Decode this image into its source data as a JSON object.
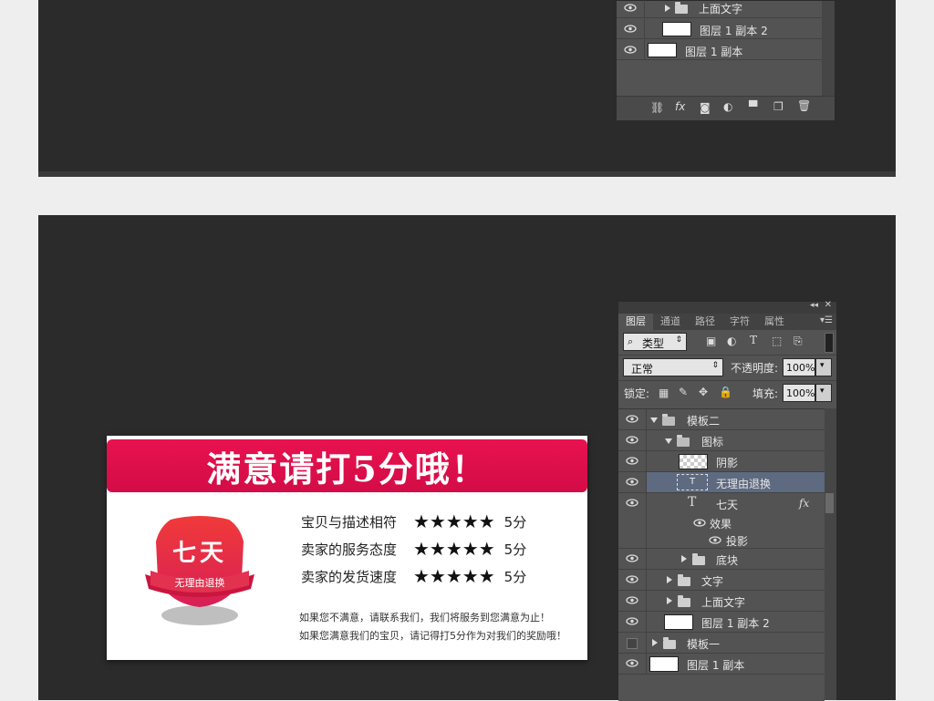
{
  "top_panel": {
    "layers": [
      {
        "name": "上面文字",
        "type": "folder"
      },
      {
        "name": "图层 1 副本 2",
        "type": "layer"
      },
      {
        "name": "图层 1 副本",
        "type": "layer"
      }
    ],
    "footer_icons": [
      "link-icon",
      "fx-icon",
      "mask-icon",
      "adjustment-icon",
      "folder-icon",
      "new-layer-icon",
      "trash-icon"
    ]
  },
  "panel": {
    "tabs": [
      "图层",
      "通道",
      "路径",
      "字符",
      "属性"
    ],
    "filter_label": "类型",
    "blend_mode": "正常",
    "opacity_label": "不透明度:",
    "opacity_value": "100%",
    "lock_label": "锁定:",
    "fill_label": "填充:",
    "fill_value": "100%",
    "layers": [
      {
        "name": "模板二",
        "kind": "group-open"
      },
      {
        "name": "图标",
        "kind": "group-open"
      },
      {
        "name": "阴影",
        "kind": "layer-transparent"
      },
      {
        "name": "无理由退换",
        "kind": "text-selected"
      },
      {
        "name": "七天",
        "kind": "text-fx"
      },
      {
        "name": "效果",
        "kind": "effect"
      },
      {
        "name": "投影",
        "kind": "effect-item"
      },
      {
        "name": "底块",
        "kind": "group-closed"
      },
      {
        "name": "文字",
        "kind": "group-closed"
      },
      {
        "name": "上面文字",
        "kind": "group-closed"
      },
      {
        "name": "图层 1 副本 2",
        "kind": "layer"
      },
      {
        "name": "模板一",
        "kind": "group-closed-hidden"
      },
      {
        "name": "图层 1 副本",
        "kind": "layer"
      }
    ],
    "fx_badge": "fx"
  },
  "ad": {
    "title": "满意请打5分哦！",
    "badge_big": "七天",
    "badge_small": "无理由退换",
    "ratings": [
      {
        "label": "宝贝与描述相符",
        "stars": "★★★★★",
        "score": "5分"
      },
      {
        "label": "卖家的服务态度",
        "stars": "★★★★★",
        "score": "5分"
      },
      {
        "label": "卖家的发货速度",
        "stars": "★★★★★",
        "score": "5分"
      }
    ],
    "note1": "如果您不满意，请联系我们，我们将服务到您满意为止！",
    "note2": "如果您满意我们的宝贝，请记得打5分作为对我们的奖励哦！",
    "colors": {
      "header": "#e0104c",
      "badge": "#e8243c"
    }
  }
}
